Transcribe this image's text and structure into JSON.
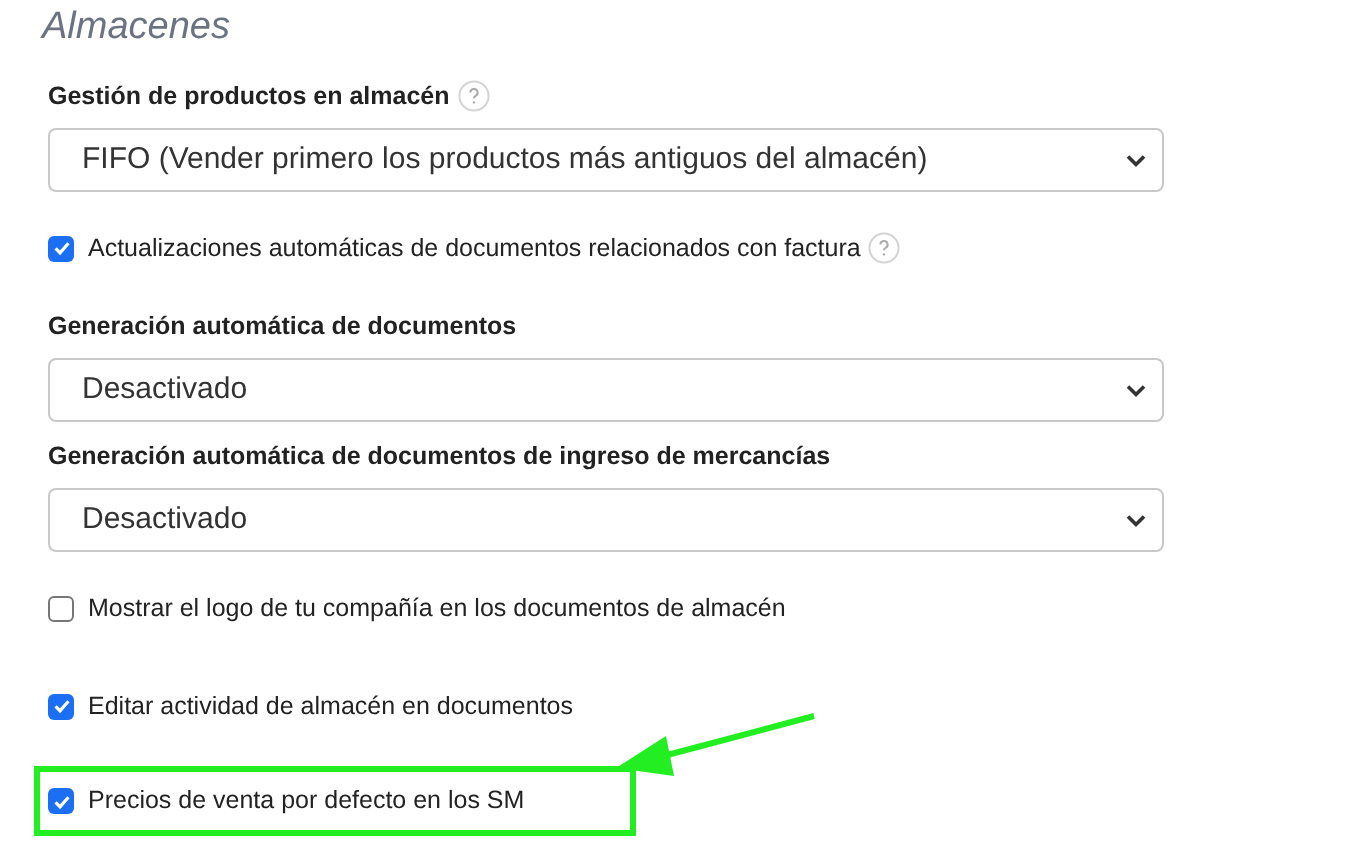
{
  "section_title": "Almacenes",
  "items": [
    {
      "kind": "select",
      "label": "Gestión de productos en almacén",
      "help": true,
      "value": "FIFO (Vender primero los productos más antiguos del almacén)"
    },
    {
      "kind": "checkbox",
      "label": "Actualizaciones automáticas de documentos relacionados con factura",
      "help": true,
      "checked": true,
      "highlighted": false
    },
    {
      "kind": "select",
      "label": "Generación automática de documentos",
      "help": false,
      "value": "Desactivado"
    },
    {
      "kind": "select",
      "label": "Generación automática de documentos de ingreso de mercancías",
      "help": false,
      "value": "Desactivado"
    },
    {
      "kind": "checkbox",
      "label": "Mostrar el logo de tu compañía en los documentos de almacén",
      "help": false,
      "checked": false,
      "highlighted": false
    },
    {
      "kind": "checkbox",
      "label": "Editar actividad de almacén en documentos",
      "help": false,
      "checked": true,
      "highlighted": false
    },
    {
      "kind": "checkbox",
      "label": "Precios de venta por defecto en los SM",
      "help": false,
      "checked": true,
      "highlighted": true
    }
  ]
}
